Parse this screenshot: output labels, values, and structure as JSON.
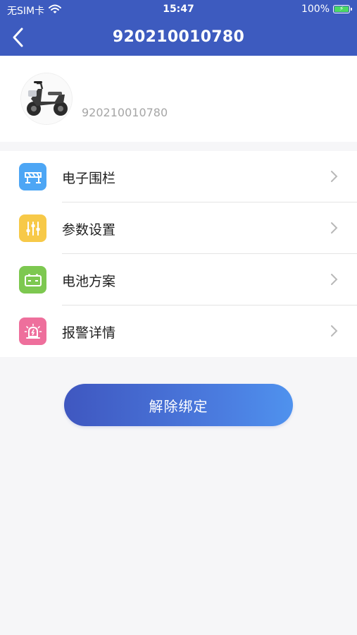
{
  "status_bar": {
    "carrier": "无SIM卡",
    "time": "15:47",
    "battery": "100%"
  },
  "nav": {
    "title": "920210010780"
  },
  "profile": {
    "device_id": "920210010780"
  },
  "menu": {
    "items": [
      {
        "label": "电子围栏",
        "icon": "fence-icon",
        "color": "#4da6f5"
      },
      {
        "label": "参数设置",
        "icon": "sliders-icon",
        "color": "#f7c948"
      },
      {
        "label": "电池方案",
        "icon": "battery-icon",
        "color": "#7dc850"
      },
      {
        "label": "报警详情",
        "icon": "alarm-icon",
        "color": "#ee6f9c"
      }
    ]
  },
  "actions": {
    "unbind_label": "解除绑定"
  },
  "colors": {
    "header": "#3d5bbf",
    "background": "#f6f6f8"
  }
}
